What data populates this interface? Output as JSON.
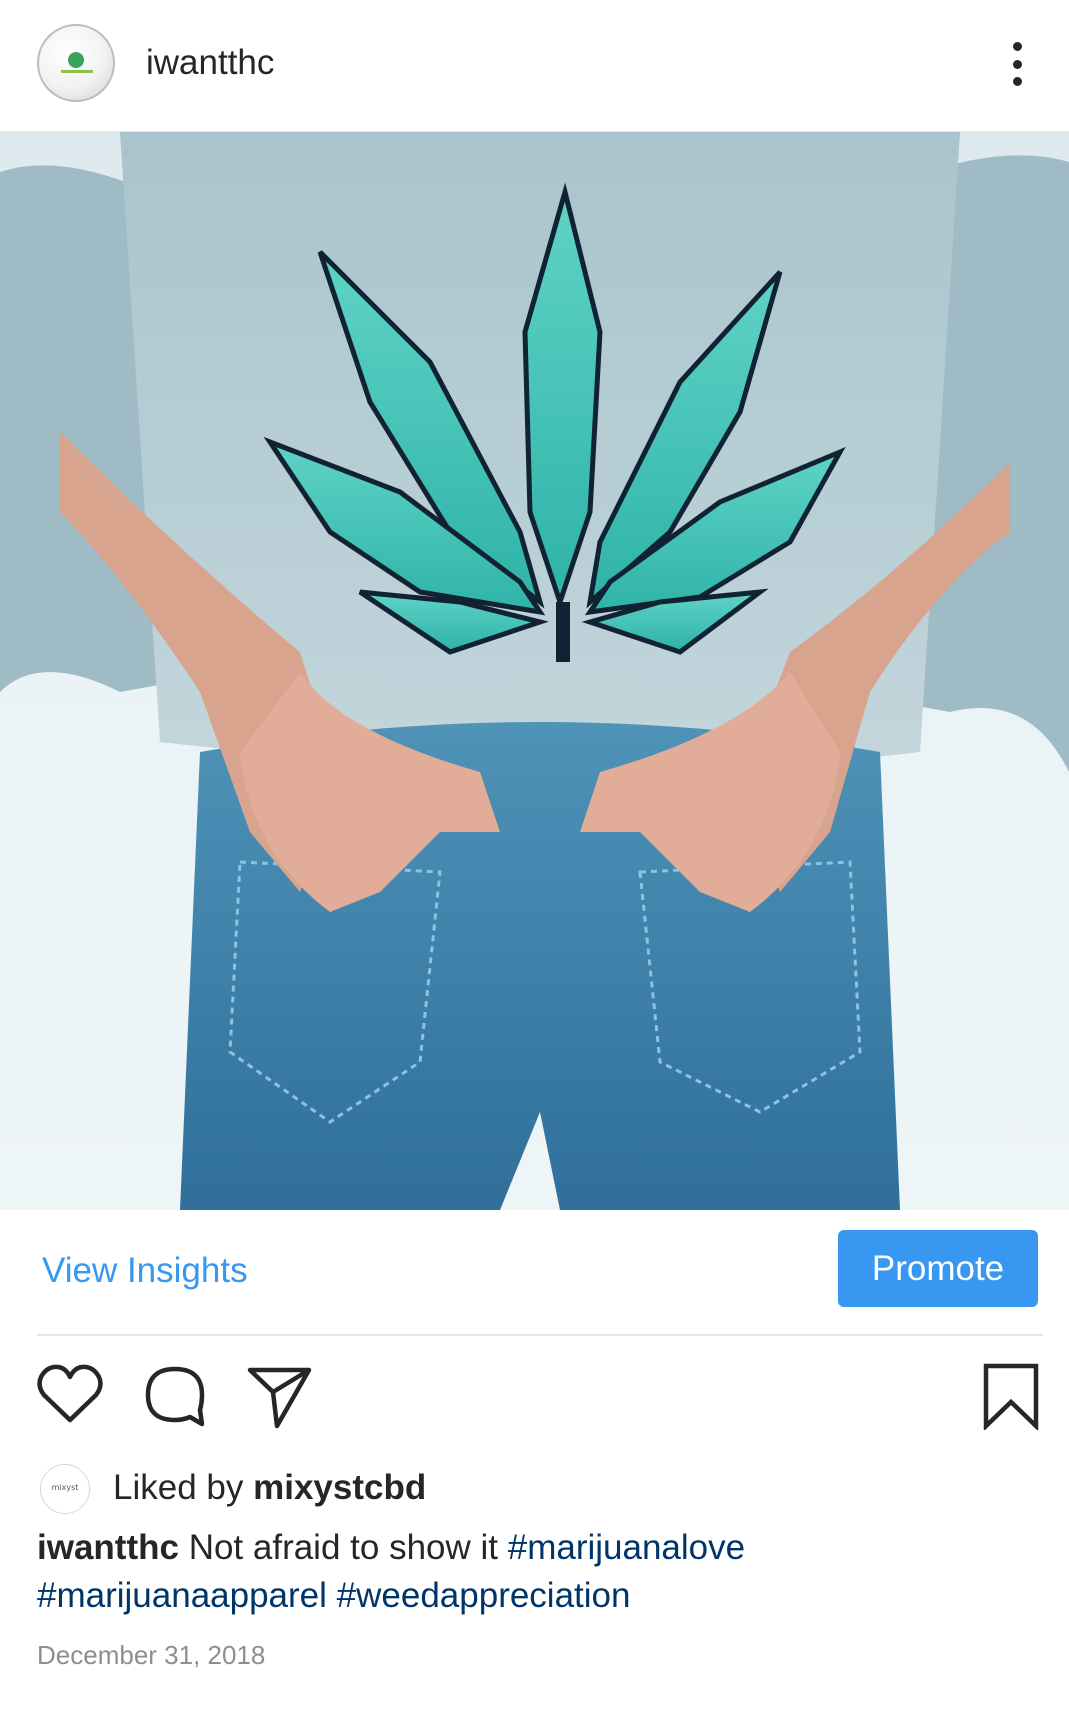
{
  "post": {
    "username": "iwantthc",
    "more_icon": "more-vertical-icon"
  },
  "insights": {
    "view_label": "View Insights",
    "promote_label": "Promote"
  },
  "colors": {
    "accent": "#3897f0",
    "hashtag": "#003569",
    "muted": "#8e8e8e"
  },
  "action_icons": [
    "heart-icon",
    "comment-icon",
    "share-icon",
    "bookmark-icon"
  ],
  "likes": {
    "prefix": "Liked by",
    "user": "mixystcbd"
  },
  "caption": {
    "user": "iwantthc",
    "text": "Not afraid to show it",
    "hashtags": [
      "#marijuanalove",
      "#marijuanaapparel",
      "#weedappreciation"
    ]
  },
  "timestamp": "December 31, 2018"
}
